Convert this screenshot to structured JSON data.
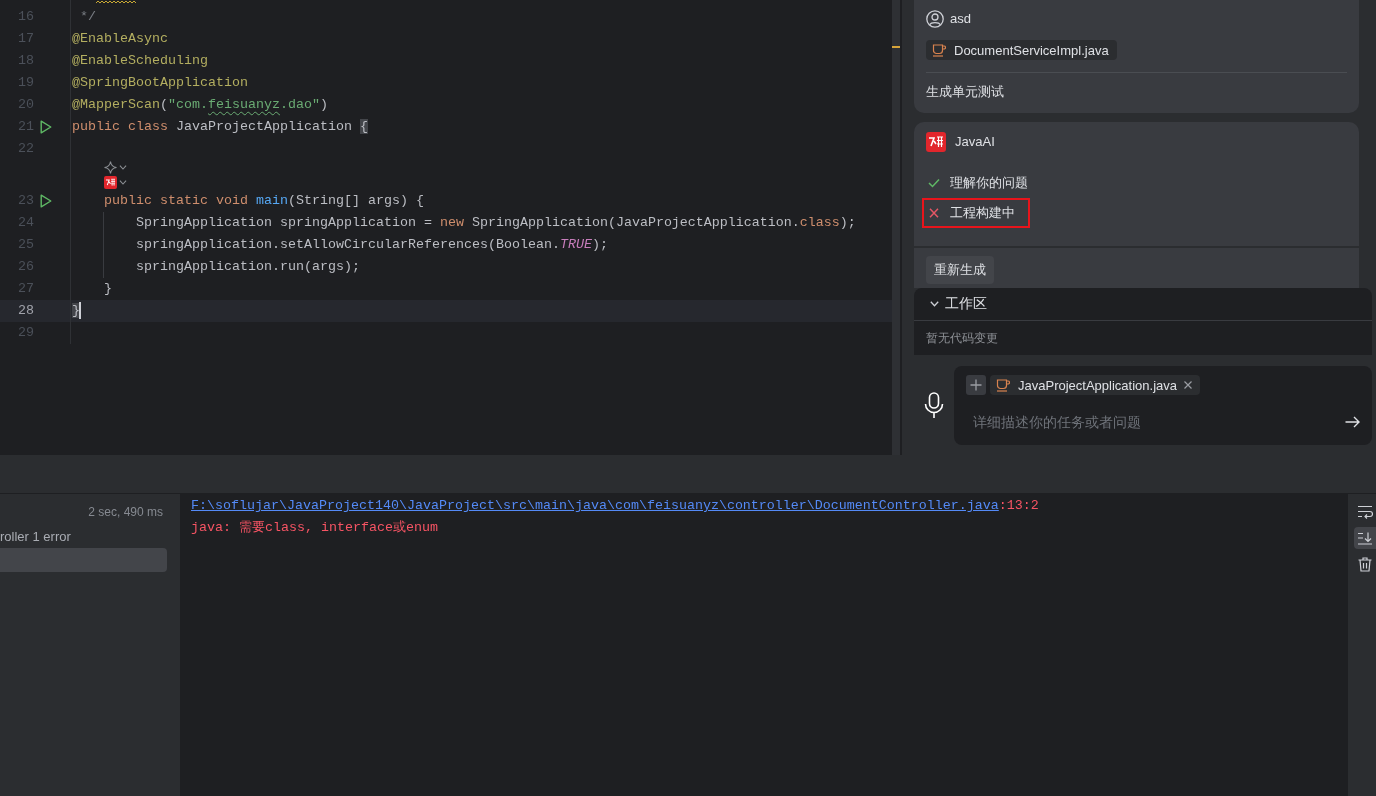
{
  "editor": {
    "lines": [
      {
        "kind": "clipped"
      },
      {
        "kind": "code",
        "number": "16",
        "run": false,
        "current": false,
        "tokens": [
          {
            "kind": "comment",
            "text": " */"
          }
        ]
      },
      {
        "kind": "code",
        "number": "17",
        "run": false,
        "current": false,
        "tokens": [
          {
            "kind": "annotation",
            "text": "@EnableAsync"
          }
        ]
      },
      {
        "kind": "code",
        "number": "18",
        "run": false,
        "current": false,
        "tokens": [
          {
            "kind": "annotation",
            "text": "@EnableScheduling"
          }
        ]
      },
      {
        "kind": "code",
        "number": "19",
        "run": false,
        "current": false,
        "tokens": [
          {
            "kind": "annotation",
            "text": "@SpringBootApplication"
          }
        ]
      },
      {
        "kind": "code",
        "number": "20",
        "run": false,
        "current": false,
        "tokens": [
          {
            "kind": "annotation",
            "text": "@MapperScan"
          },
          {
            "kind": "plain",
            "text": "("
          },
          {
            "kind": "string",
            "text": "\"com."
          },
          {
            "kind": "typo",
            "text": "feisuanyz"
          },
          {
            "kind": "string",
            "text": ".dao\""
          },
          {
            "kind": "plain",
            "text": ")"
          }
        ]
      },
      {
        "kind": "code",
        "number": "21",
        "run": true,
        "current": false,
        "tokens": [
          {
            "kind": "keyword",
            "text": "public"
          },
          {
            "kind": "keyword",
            "text": " class"
          },
          {
            "kind": "plain",
            "text": " JavaProjectApplication "
          },
          {
            "kind": "brace",
            "text": "{"
          }
        ]
      },
      {
        "kind": "code",
        "number": "22",
        "run": false,
        "current": false
      },
      {
        "kind": "hint"
      },
      {
        "kind": "logo"
      },
      {
        "kind": "code",
        "number": "23",
        "run": true,
        "current": false,
        "tokens": [
          {
            "kind": "keyword",
            "text": "    public"
          },
          {
            "kind": "keyword",
            "text": " static"
          },
          {
            "kind": "keyword",
            "text": " void"
          },
          {
            "kind": "method",
            "text": " main"
          },
          {
            "kind": "plain",
            "text": "(String[] args) {"
          }
        ]
      },
      {
        "kind": "code",
        "number": "24",
        "run": false,
        "current": false,
        "guide": true,
        "tokens": [
          {
            "kind": "plain",
            "text": "        SpringApplication springApplication = "
          },
          {
            "kind": "keyword",
            "text": "new"
          },
          {
            "kind": "plain",
            "text": " SpringApplication(JavaProjectApplication."
          },
          {
            "kind": "keyword",
            "text": "class"
          },
          {
            "kind": "plain",
            "text": ");"
          }
        ]
      },
      {
        "kind": "code",
        "number": "25",
        "run": false,
        "current": false,
        "guide": true,
        "tokens": [
          {
            "kind": "plain",
            "text": "        springApplication.setAllowCircularReferences(Boolean."
          },
          {
            "kind": "constant",
            "text": "TRUE"
          },
          {
            "kind": "plain",
            "text": ");"
          }
        ]
      },
      {
        "kind": "code",
        "number": "26",
        "run": false,
        "current": false,
        "guide": true,
        "tokens": [
          {
            "kind": "plain",
            "text": "        springApplication.run(args);"
          }
        ]
      },
      {
        "kind": "code",
        "number": "27",
        "run": false,
        "current": false,
        "tokens": [
          {
            "kind": "plain",
            "text": "    }"
          }
        ]
      },
      {
        "kind": "code",
        "number": "28",
        "run": false,
        "current": true,
        "tokens": [
          {
            "kind": "brace",
            "text": "}"
          }
        ]
      },
      {
        "kind": "code",
        "number": "29",
        "run": false,
        "current": false
      }
    ]
  },
  "assistant": {
    "messages": [
      {
        "kind": "user",
        "author": "asd",
        "file": "DocumentServiceImpl.java",
        "text": "生成单元测试"
      },
      {
        "kind": "bot",
        "author": "JavaAI",
        "steps": [
          {
            "label": "理解你的问题",
            "done": true,
            "highlighted": false
          },
          {
            "label": "工程构建中",
            "done": false,
            "highlighted": true
          }
        ],
        "action": "重新生成"
      }
    ],
    "workspace": {
      "title": "工作区",
      "expanded": true,
      "empty_text": "暂无代码变更"
    },
    "composer": {
      "attachment": "JavaProjectApplication.java",
      "placeholder": "详细描述你的任务或者问题"
    }
  },
  "build": {
    "tree": [
      {
        "time": "2 sec, 490 ms",
        "selected": false
      },
      {
        "label": "roller 1 error",
        "selected": false
      },
      {
        "selected": true
      }
    ],
    "console": [
      {
        "kind": "link",
        "text": "F:\\soflujar\\JavaProject140\\JavaProject\\src\\main\\java\\com\\feisuanyz\\controller\\DocumentController.java",
        "suffix": ":13:2"
      },
      {
        "kind": "error",
        "text": "java: 需要class, interface或enum"
      }
    ],
    "tools": [
      {
        "selected": false
      },
      {
        "selected": true
      },
      {
        "selected": false
      }
    ]
  }
}
